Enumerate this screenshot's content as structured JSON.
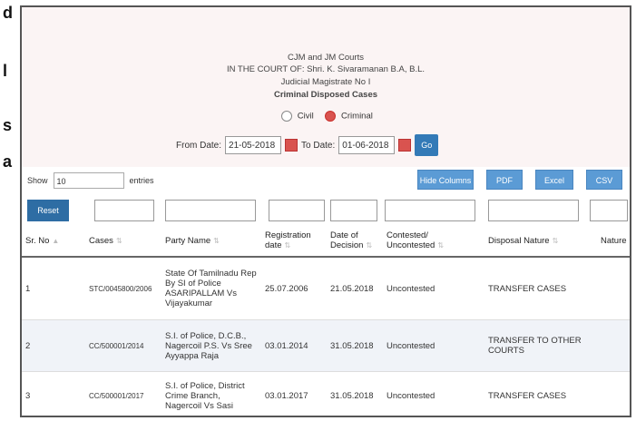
{
  "left_letters": [
    "d",
    "l",
    "s",
    "a"
  ],
  "header": {
    "line1": "CJM and JM Courts",
    "line2": "IN THE COURT OF: Shri. K. Sivaramanan B.A, B.L.",
    "line3": "Judicial Magistrate No I",
    "line4": "Criminal Disposed Cases"
  },
  "case_type": {
    "civil_label": "Civil",
    "criminal_label": "Criminal",
    "selected": "Criminal"
  },
  "dates": {
    "from_label": "From Date:",
    "from_value": "21-05-2018",
    "to_label": "To Date:",
    "to_value": "01-06-2018",
    "go_label": "Go"
  },
  "show": {
    "prefix": "Show",
    "value": "10",
    "suffix": "entries"
  },
  "buttons": {
    "hide_columns": "Hide Columns",
    "pdf": "PDF",
    "excel": "Excel",
    "csv": "CSV"
  },
  "reset_label": "Reset",
  "columns": [
    "Sr. No",
    "Cases",
    "Party Name",
    "Registration date",
    "Date of Decision",
    "Contested/ Uncontested",
    "Disposal Nature",
    "Nature"
  ],
  "rows": [
    {
      "sr": "1",
      "case": "STC/0045800/2006",
      "party": "State Of Tamilnadu Rep By SI of Police ASARIPALLAM Vs Vijayakumar",
      "reg": "25.07.2006",
      "dec": "21.05.2018",
      "contested": "Uncontested",
      "disposal": "TRANSFER CASES",
      "nature": ""
    },
    {
      "sr": "2",
      "case": "CC/500001/2014",
      "party": "S.I. of Police, D.C.B., Nagercoil P.S. Vs Sree Ayyappa Raja",
      "reg": "03.01.2014",
      "dec": "31.05.2018",
      "contested": "Uncontested",
      "disposal": "TRANSFER TO OTHER COURTS",
      "nature": ""
    },
    {
      "sr": "3",
      "case": "CC/500001/2017",
      "party": "S.I. of Police, District Crime Branch, Nagercoil Vs Sasi",
      "reg": "03.01.2017",
      "dec": "31.05.2018",
      "contested": "Uncontested",
      "disposal": "TRANSFER CASES",
      "nature": ""
    }
  ]
}
